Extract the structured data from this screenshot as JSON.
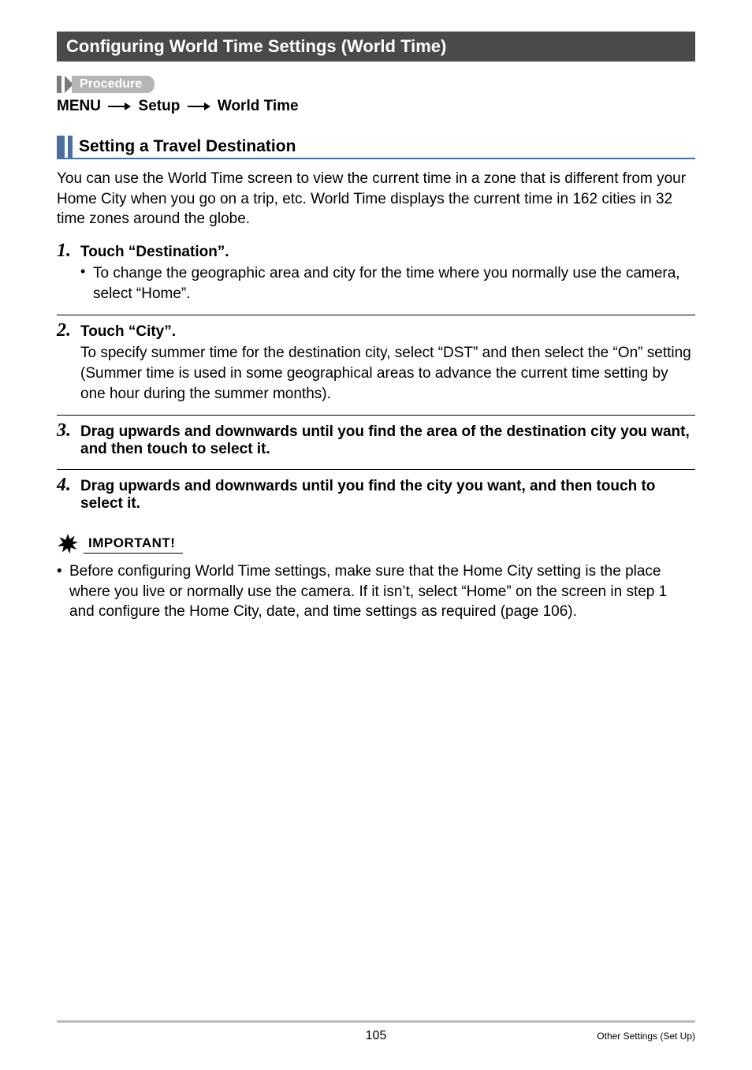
{
  "title_bar": "Configuring World Time Settings (World Time)",
  "procedure_label": "Procedure",
  "breadcrumb": {
    "a": "MENU",
    "b": "Setup",
    "c": "World Time"
  },
  "sub_heading": "Setting a Travel Destination",
  "intro": "You can use the World Time screen to view the current time in a zone that is different from your Home City when you go on a trip, etc. World Time displays the current time in 162 cities in 32 time zones around the globe.",
  "steps": [
    {
      "num": "1.",
      "title": "Touch “Destination”.",
      "bullet": "To change the geographic area and city for the time where you normally use the camera, select “Home”."
    },
    {
      "num": "2.",
      "title": "Touch “City”.",
      "body": "To specify summer time for the destination city, select “DST” and then select the “On” setting (Summer time is used in some geographical areas to advance the current time setting by one hour during the summer months)."
    },
    {
      "num": "3.",
      "title": "Drag upwards and downwards until you find the area of the destination city you want, and then touch to select it."
    },
    {
      "num": "4.",
      "title": "Drag upwards and downwards until you find the city you want, and then touch to select it."
    }
  ],
  "important_label": "IMPORTANT!",
  "important_text": "Before configuring World Time settings, make sure that the Home City setting is the place where you live or normally use the camera. If it isn’t, select “Home” on the screen in step 1 and configure the Home City, date, and time settings as required (page 106).",
  "footer": {
    "page": "105",
    "section": "Other Settings (Set Up)"
  }
}
